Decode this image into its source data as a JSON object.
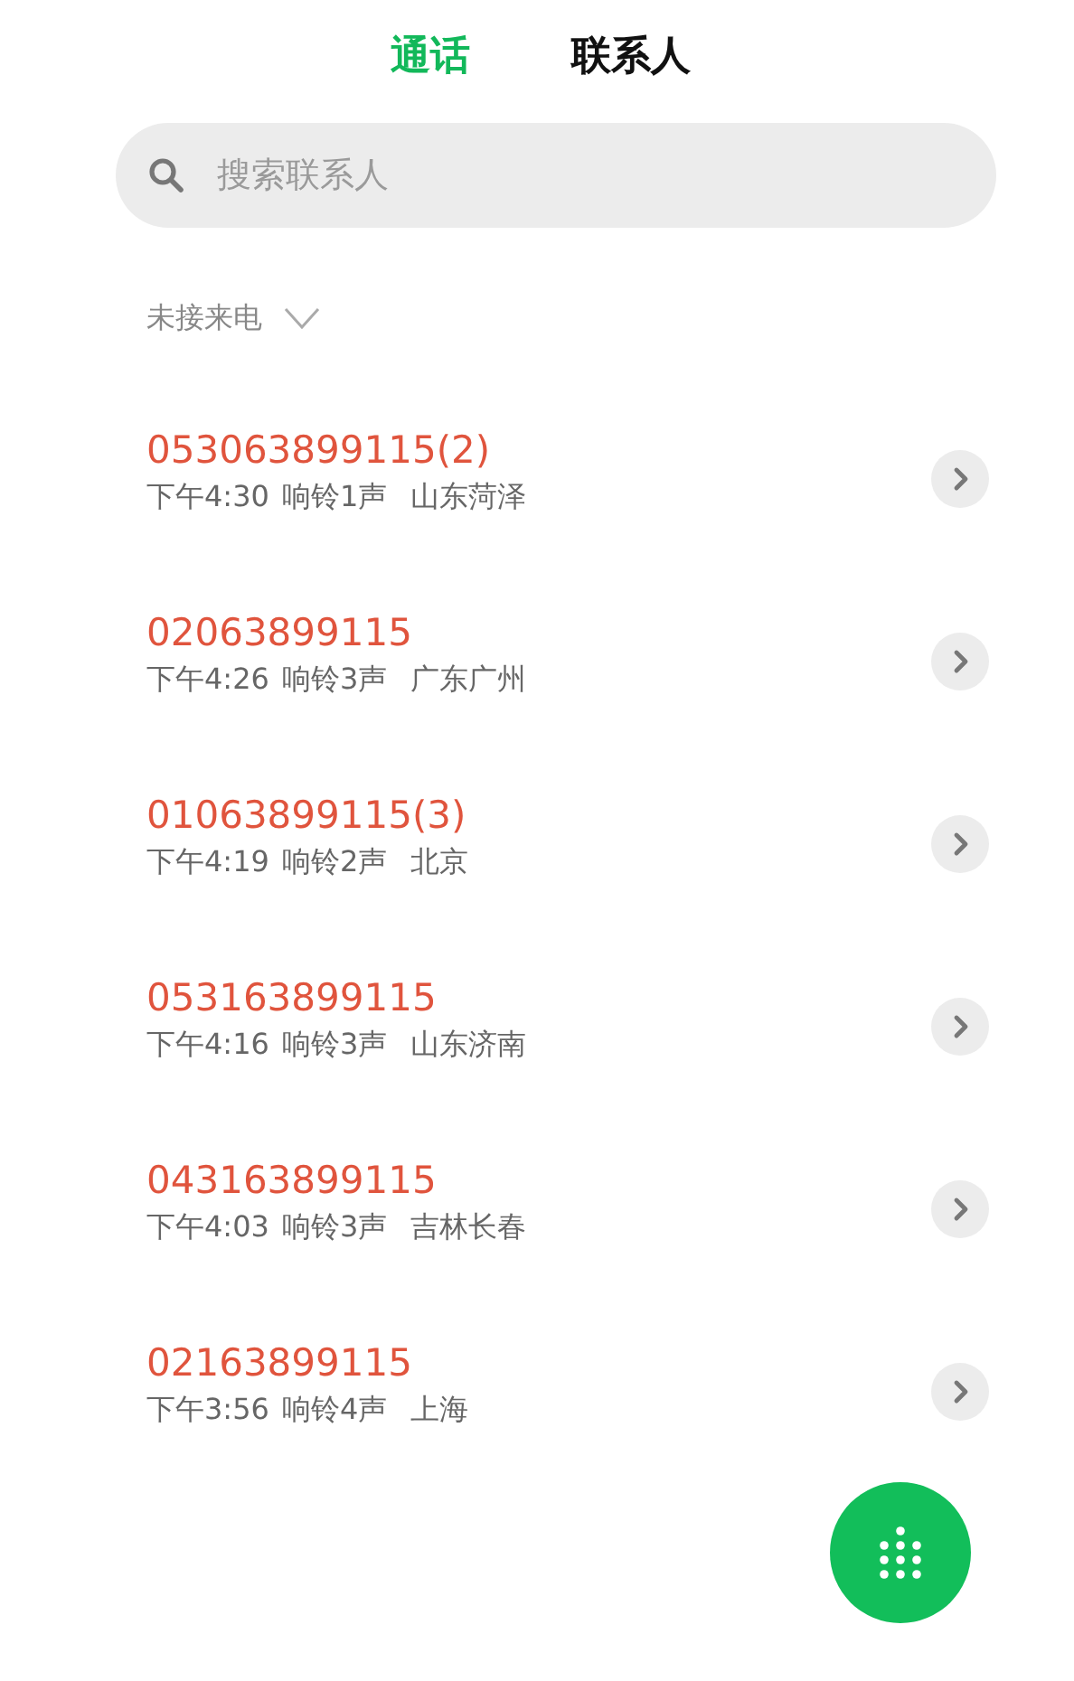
{
  "tabs": [
    {
      "label": "通话",
      "selected": true
    },
    {
      "label": "联系人",
      "selected": false
    }
  ],
  "search": {
    "placeholder": "搜索联系人"
  },
  "filter": {
    "label": "未接来电",
    "expanded": false
  },
  "calls": [
    {
      "number": "053063899115(2)",
      "time": "下午4:30",
      "rings": "响铃1声",
      "location": "山东菏泽",
      "missed": true
    },
    {
      "number": "02063899115",
      "time": "下午4:26",
      "rings": "响铃3声",
      "location": "广东广州",
      "missed": true
    },
    {
      "number": "01063899115(3)",
      "time": "下午4:19",
      "rings": "响铃2声",
      "location": "北京",
      "missed": true
    },
    {
      "number": "053163899115",
      "time": "下午4:16",
      "rings": "响铃3声",
      "location": "山东济南",
      "missed": true
    },
    {
      "number": "043163899115",
      "time": "下午4:03",
      "rings": "响铃3声",
      "location": "吉林长春",
      "missed": true
    },
    {
      "number": "02163899115",
      "time": "下午3:56",
      "rings": "响铃4声",
      "location": "上海",
      "missed": true
    }
  ]
}
